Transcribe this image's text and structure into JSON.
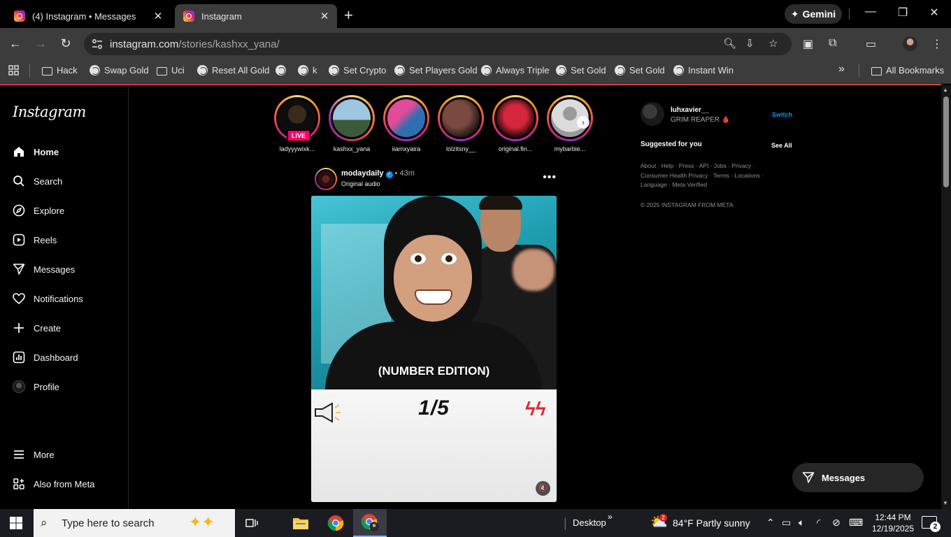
{
  "browser": {
    "tabs": [
      {
        "title": "(4) Instagram • Messages",
        "active": false
      },
      {
        "title": "Instagram",
        "active": true
      }
    ],
    "new_tab": "+",
    "gemini_label": "Gemini",
    "url_host": "instagram.com",
    "url_path": "/stories/kashxx_yana/",
    "bookmarks": [
      {
        "label": "Hack",
        "icon": "folder-icon"
      },
      {
        "label": "Swap Gold",
        "icon": "globe-icon"
      },
      {
        "label": "Uci",
        "icon": "folder-icon"
      },
      {
        "label": "Reset All Gold",
        "icon": "globe-icon"
      },
      {
        "label": "",
        "icon": "globe-icon"
      },
      {
        "label": "k",
        "icon": "globe-icon"
      },
      {
        "label": "Set Crypto",
        "icon": "globe-icon"
      },
      {
        "label": "Set Players Gold",
        "icon": "globe-icon"
      },
      {
        "label": "Always Triple",
        "icon": "globe-icon"
      },
      {
        "label": "Set Gold",
        "icon": "globe-icon"
      },
      {
        "label": "Set Gold",
        "icon": "globe-icon"
      },
      {
        "label": "Instant Win",
        "icon": "globe-icon"
      }
    ],
    "more_bookmarks": "»",
    "all_bookmarks": "All Bookmarks"
  },
  "instagram": {
    "logo": "Instagram",
    "nav": [
      {
        "label": "Home",
        "icon": "home-icon",
        "active": true
      },
      {
        "label": "Search",
        "icon": "search-icon"
      },
      {
        "label": "Explore",
        "icon": "compass-icon"
      },
      {
        "label": "Reels",
        "icon": "reels-icon"
      },
      {
        "label": "Messages",
        "icon": "messenger-icon"
      },
      {
        "label": "Notifications",
        "icon": "heart-icon"
      },
      {
        "label": "Create",
        "icon": "plus-icon"
      },
      {
        "label": "Dashboard",
        "icon": "dashboard-icon"
      },
      {
        "label": "Profile",
        "icon": "avatar"
      }
    ],
    "nav_bottom": [
      {
        "label": "More",
        "icon": "menu-icon"
      },
      {
        "label": "Also from Meta",
        "icon": "meta-grid-icon"
      }
    ],
    "stories": [
      {
        "name": "ladyyywixk...",
        "live": true,
        "colors": [
          "#3a2a1a",
          "#0d0d0d"
        ]
      },
      {
        "name": "kashxx_yana",
        "live": false,
        "colors": [
          "#9ec6e0",
          "#3b5a3a"
        ]
      },
      {
        "name": "iiamxyaira",
        "live": false,
        "colors": [
          "#e04b9a",
          "#2d6fb0"
        ]
      },
      {
        "name": "lolzitsny__",
        "live": false,
        "colors": [
          "#7a4a40",
          "#2a1a18"
        ]
      },
      {
        "name": "original.fin...",
        "live": false,
        "colors": [
          "#d4263c",
          "#3a0a10"
        ]
      },
      {
        "name": "mybarbie...",
        "live": false,
        "colors": [
          "#dcdcdc",
          "#9a9a9a"
        ]
      }
    ],
    "live_label": "LIVE",
    "story_next": "›",
    "post": {
      "username": "modaydaily",
      "verified_mark": "✓",
      "time": "• 43m",
      "audio": "Original audio",
      "more": "•••",
      "caption": "(NUMBER EDITION)",
      "counter": "1/5",
      "mute": "🔇"
    },
    "sidebar": {
      "username": "luhxavier__",
      "name": "GRIM REAPER",
      "name_emoji": "🩸",
      "switch": "Switch",
      "suggested": "Suggested for you",
      "see_all": "See All",
      "footer_links": "About · Help · Press · API · Jobs · Privacy · Consumer Health Privacy · Terms · Locations · Language · Meta Verified",
      "copyright": "© 2025 INSTAGRAM FROM META"
    },
    "messages_bar": "Messages"
  },
  "taskbar": {
    "search_placeholder": "Type here to search",
    "desktop_label": "Desktop",
    "desktop_chevron": "»",
    "weather": "84°F  Partly sunny",
    "weather_badge": "2",
    "time": "12:44 PM",
    "date": "12/19/2025",
    "notif_count": "2"
  }
}
